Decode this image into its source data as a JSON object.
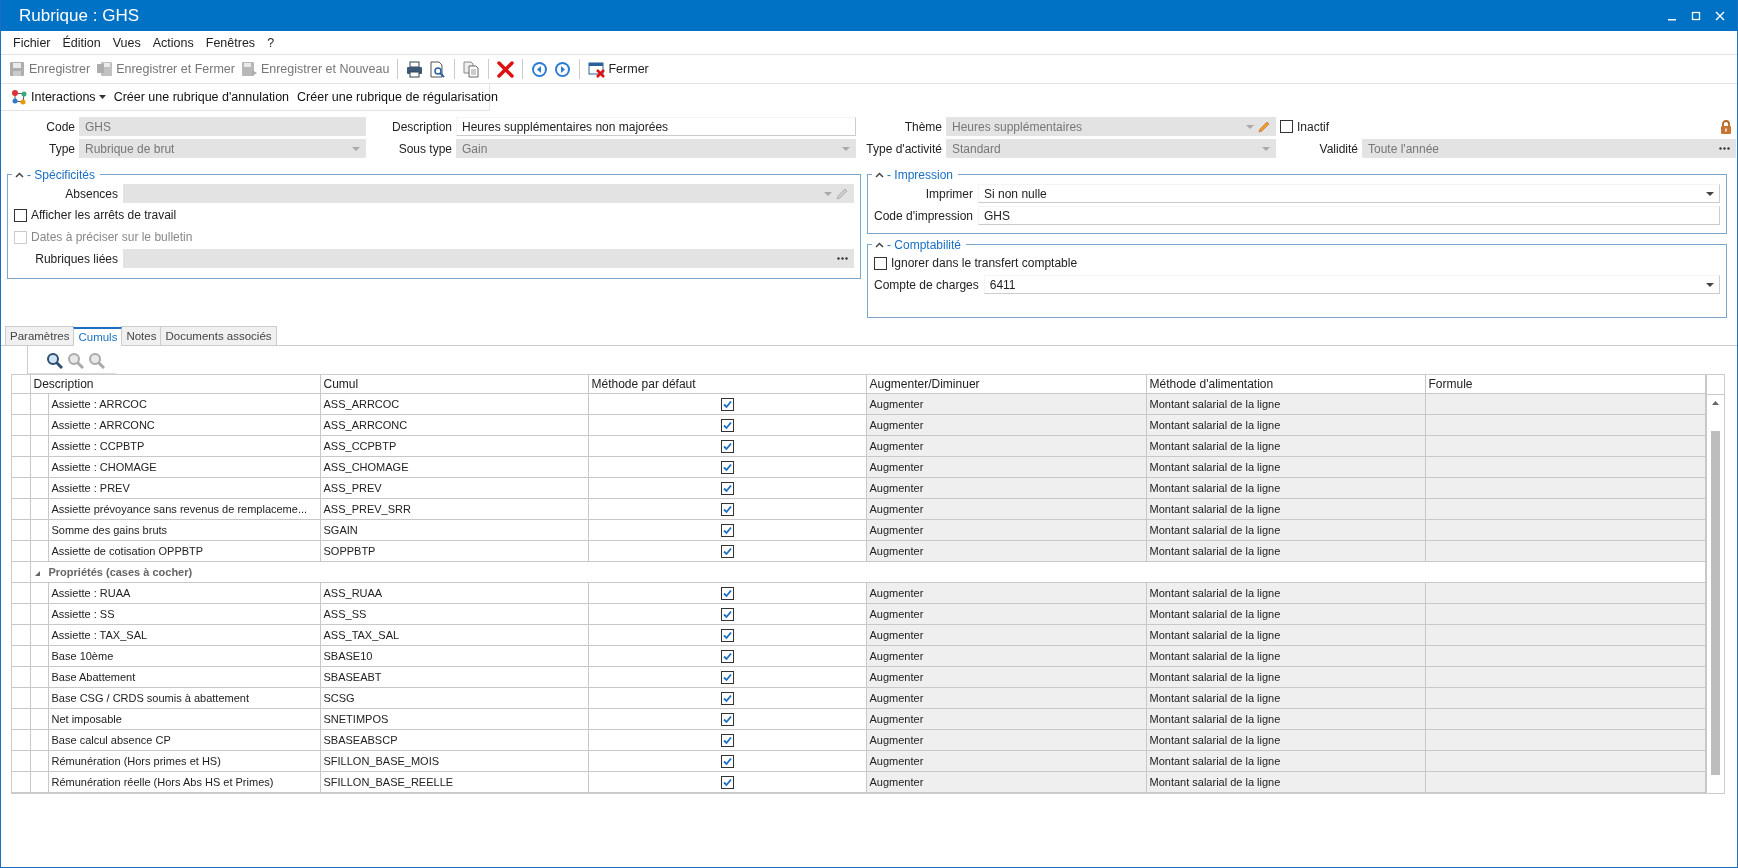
{
  "window": {
    "title": "Rubrique : GHS"
  },
  "menu": [
    "Fichier",
    "Édition",
    "Vues",
    "Actions",
    "Fenêtres",
    "?"
  ],
  "toolbar": [
    [
      {
        "kind": "save",
        "label": "Enregistrer",
        "disabled": true
      },
      {
        "kind": "save-close",
        "label": "Enregistrer et Fermer",
        "disabled": true
      },
      {
        "kind": "save-new",
        "label": "Enregistrer et Nouveau",
        "disabled": true
      }
    ],
    [
      {
        "kind": "print",
        "disabled": false
      },
      {
        "kind": "preview",
        "disabled": false
      }
    ],
    [
      {
        "kind": "copy",
        "disabled": false
      }
    ],
    [
      {
        "kind": "delete",
        "disabled": false
      }
    ],
    [
      {
        "kind": "back",
        "disabled": false
      },
      {
        "kind": "forward",
        "disabled": false
      }
    ],
    [
      {
        "kind": "close",
        "label": "Fermer",
        "disabled": false
      }
    ]
  ],
  "interactions": {
    "menu_label": "Interactions",
    "actions": [
      "Créer une rubrique d'annulation",
      "Créer une rubrique de régularisation"
    ]
  },
  "header": {
    "rows": [
      [
        {
          "kind": "text",
          "label": "Code",
          "value": "GHS",
          "disabled": true
        },
        {
          "kind": "text",
          "label": "Description",
          "value": "Heures supplémentaires non majorées",
          "disabled": false
        },
        {
          "kind": "combo-edit",
          "label": "Thème",
          "value": "Heures supplémentaires",
          "disabled": true
        },
        {
          "kind": "checkbox",
          "label": "Inactif",
          "checked": false,
          "disabled": false
        }
      ],
      [
        {
          "kind": "combo",
          "label": "Type",
          "value": "Rubrique de brut",
          "disabled": true
        },
        {
          "kind": "combo",
          "label": "Sous type",
          "value": "Gain",
          "disabled": true
        },
        {
          "kind": "combo",
          "label": "Type d'activité",
          "value": "Standard",
          "disabled": true
        },
        {
          "kind": "ellipsis",
          "label": "Validité",
          "value": "Toute l'année",
          "disabled": true
        }
      ]
    ]
  },
  "specificites": {
    "title": "- Spécificités",
    "expanded": true,
    "fields": [
      {
        "kind": "combo-edit",
        "label": "Absences",
        "disabled": true
      },
      {
        "kind": "checkbox",
        "label": "Afficher les arrêts de travail",
        "checked": false,
        "disabled": false
      },
      {
        "kind": "checkbox",
        "label": "Dates à préciser sur le bulletin",
        "checked": false,
        "disabled": true
      },
      {
        "kind": "ellipsis",
        "label": "Rubriques liées",
        "disabled": true
      }
    ]
  },
  "impression": {
    "title": "- Impression",
    "expanded": true,
    "fields": [
      {
        "kind": "combo",
        "label": "Imprimer",
        "value": "Si non nulle",
        "disabled": false
      },
      {
        "kind": "text",
        "label": "Code d'impression",
        "value": "GHS",
        "disabled": false
      }
    ]
  },
  "comptabilite": {
    "title": "- Comptabilité",
    "expanded": true,
    "fields": [
      {
        "kind": "checkbox",
        "label": "Ignorer dans le transfert comptable",
        "checked": false,
        "disabled": false
      },
      {
        "kind": "combo",
        "label": "Compte de charges",
        "value": "6411",
        "disabled": false
      }
    ]
  },
  "tabs": [
    {
      "label": "Paramètres",
      "selected": false
    },
    {
      "label": "Cumuls",
      "selected": true
    },
    {
      "label": "Notes",
      "selected": false
    },
    {
      "label": "Documents associés",
      "selected": false
    }
  ],
  "grid_tools": [
    {
      "disabled": false
    },
    {
      "disabled": true
    },
    {
      "disabled": true
    }
  ],
  "table": {
    "columns": [
      "Description",
      "Cumul",
      "Méthode par défaut",
      "Augmenter/Diminuer",
      "Méthode d'alimentation",
      "Formule"
    ],
    "groups": [
      {
        "rows": [
          {
            "description": "Assiette : ARRCOC",
            "cumul": "ASS_ARRCOC",
            "default_method": true,
            "direction": "Augmenter",
            "feed_method": "Montant salarial de la ligne"
          },
          {
            "description": "Assiette : ARRCONC",
            "cumul": "ASS_ARRCONC",
            "default_method": true,
            "direction": "Augmenter",
            "feed_method": "Montant salarial de la ligne"
          },
          {
            "description": "Assiette : CCPBTP",
            "cumul": "ASS_CCPBTP",
            "default_method": true,
            "direction": "Augmenter",
            "feed_method": "Montant salarial de la ligne"
          },
          {
            "description": "Assiette : CHOMAGE",
            "cumul": "ASS_CHOMAGE",
            "default_method": true,
            "direction": "Augmenter",
            "feed_method": "Montant salarial de la ligne"
          },
          {
            "description": "Assiette : PREV",
            "cumul": "ASS_PREV",
            "default_method": true,
            "direction": "Augmenter",
            "feed_method": "Montant salarial de la ligne"
          },
          {
            "description": "Assiette prévoyance sans revenus de remplaceme...",
            "cumul": "ASS_PREV_SRR",
            "default_method": true,
            "direction": "Augmenter",
            "feed_method": "Montant salarial de la ligne"
          },
          {
            "description": "Somme des gains bruts",
            "cumul": "SGAIN",
            "default_method": true,
            "direction": "Augmenter",
            "feed_method": "Montant salarial de la ligne"
          },
          {
            "description": "Assiette de cotisation OPPBTP",
            "cumul": "SOPPBTP",
            "default_method": true,
            "direction": "Augmenter",
            "feed_method": "Montant salarial de la ligne"
          }
        ]
      },
      {
        "label": "Propriétés (cases à cocher)",
        "expanded": true,
        "rows": [
          {
            "description": "Assiette : RUAA",
            "cumul": "ASS_RUAA",
            "default_method": true,
            "direction": "Augmenter",
            "feed_method": "Montant salarial de la ligne"
          },
          {
            "description": "Assiette : SS",
            "cumul": "ASS_SS",
            "default_method": true,
            "direction": "Augmenter",
            "feed_method": "Montant salarial de la ligne"
          },
          {
            "description": "Assiette : TAX_SAL",
            "cumul": "ASS_TAX_SAL",
            "default_method": true,
            "direction": "Augmenter",
            "feed_method": "Montant salarial de la ligne"
          },
          {
            "description": "Base 10ème",
            "cumul": "SBASE10",
            "default_method": true,
            "direction": "Augmenter",
            "feed_method": "Montant salarial de la ligne"
          },
          {
            "description": "Base Abattement",
            "cumul": "SBASEABT",
            "default_method": true,
            "direction": "Augmenter",
            "feed_method": "Montant salarial de la ligne"
          },
          {
            "description": "Base CSG / CRDS soumis à abattement",
            "cumul": "SCSG",
            "default_method": true,
            "direction": "Augmenter",
            "feed_method": "Montant salarial de la ligne"
          },
          {
            "description": "Net imposable",
            "cumul": "SNETIMPOS",
            "default_method": true,
            "direction": "Augmenter",
            "feed_method": "Montant salarial de la ligne"
          },
          {
            "description": "Base calcul absence CP",
            "cumul": "SBASEABSCP",
            "default_method": true,
            "direction": "Augmenter",
            "feed_method": "Montant salarial de la ligne"
          },
          {
            "description": "Rémunération (Hors primes et HS)",
            "cumul": "SFILLON_BASE_MOIS",
            "default_method": true,
            "direction": "Augmenter",
            "feed_method": "Montant salarial de la ligne"
          },
          {
            "description": "Rémunération réelle (Hors Abs HS et Primes)",
            "cumul": "SFILLON_BASE_REELLE",
            "default_method": true,
            "direction": "Augmenter",
            "feed_method": "Montant salarial de la ligne"
          }
        ]
      }
    ]
  }
}
